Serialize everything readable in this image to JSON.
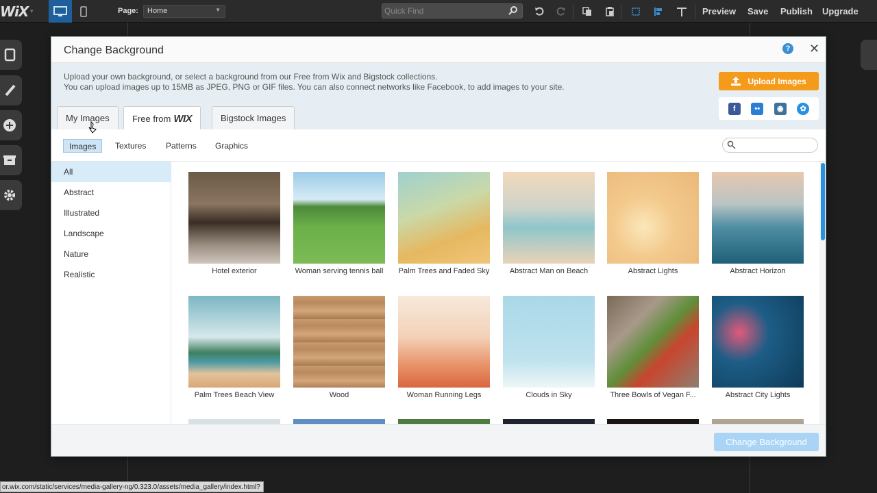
{
  "topbar": {
    "logo": "WiX",
    "page_label": "Page:",
    "page_select": "Home",
    "quickfind_placeholder": "Quick Find",
    "links": [
      "Preview",
      "Save",
      "Publish",
      "Upgrade"
    ]
  },
  "status_url": "or.wix.com/static/services/media-gallery-ng/0.323.0/assets/media_gallery/index.html?",
  "dialog": {
    "title": "Change Background",
    "description_line1": "Upload your own background, or select a background from our Free from Wix and Bigstock collections.",
    "description_line2": "You can upload images up to 15MB as JPEG, PNG or GIF files. You can also connect networks like Facebook, to add images to your site.",
    "upload_button": "Upload Images",
    "social": [
      "facebook",
      "flickr",
      "instagram",
      "picasa"
    ],
    "tabs": {
      "my_images": "My Images",
      "free_from": "Free from",
      "free_brand": "WIX",
      "bigstock": "Bigstock Images"
    },
    "subtabs": [
      "Images",
      "Textures",
      "Patterns",
      "Graphics"
    ],
    "categories": [
      "All",
      "Abstract",
      "Illustrated",
      "Landscape",
      "Nature",
      "Realistic"
    ],
    "images": [
      {
        "caption": "Hotel exterior",
        "bg": "linear-gradient(180deg,#6b5a48 0%,#8a7560 35%,#3a2e24 55%,#9b8f82 80%,#cfc6bc 100%)"
      },
      {
        "caption": "Woman serving tennis ball",
        "bg": "linear-gradient(180deg,#9ccbe8 0%,#d6ecf6 30%,#4d8a3a 38%,#6bb04a 60%,#7dbb56 100%)"
      },
      {
        "caption": "Palm Trees and Faded Sky",
        "bg": "linear-gradient(160deg,#9fd0cf 0%,#c9d9a8 40%,#e6b860 70%,#f0c578 100%)"
      },
      {
        "caption": "Abstract Man on Beach",
        "bg": "linear-gradient(180deg,#f2d9bb 0%,#cdd3c9 40%,#8fc6cb 60%,#e9d3b7 100%)"
      },
      {
        "caption": "Abstract Lights",
        "bg": "radial-gradient(circle at 40% 60%,#fbe7b9 0%,#f3c98c 40%,#eab87a 100%)"
      },
      {
        "caption": "Abstract Horizon",
        "bg": "linear-gradient(180deg,#e8c7ae 0%,#b9c4c4 35%,#4f8ea3 60%,#1f5f78 100%)"
      },
      {
        "caption": "Palm Trees Beach View",
        "bg": "linear-gradient(180deg,#7bb7c3 0%,#d6e8ea 45%,#3f7f60 62%,#4a9aa5 72%,#e2c39c 85%,#d8a874 100%)"
      },
      {
        "caption": "Wood",
        "bg": "repeating-linear-gradient(180deg,#c89a6c 0px,#b98a5e 10px,#d3a779 22px,#a97a52 34px)"
      },
      {
        "caption": "Woman Running Legs",
        "bg": "linear-gradient(180deg,#f7e9dc 0%,#f3d1b7 45%,#e8946a 75%,#d9663f 100%)"
      },
      {
        "caption": "Clouds in Sky",
        "bg": "linear-gradient(180deg,#a9d8e8 0%,#bfe2ee 70%,#eef6f7 100%)"
      },
      {
        "caption": "Three Bowls of Vegan F...",
        "bg": "linear-gradient(135deg,#7a6a5a 0%,#a8998a 30%,#5f8f3a 50%,#c8452e 65%,#8e7f70 100%)"
      },
      {
        "caption": "Abstract City Lights",
        "bg": "radial-gradient(circle at 30% 40%,#e05a7a 0%,#1d5d86 35%,#0d3b57 100%)"
      },
      {
        "caption": "",
        "bg": "linear-gradient(180deg,#d9e2e4 0%,#b6c4c6 100%)"
      },
      {
        "caption": "",
        "bg": "linear-gradient(180deg,#5f8fc4 0%,#3c6aa0 100%)"
      },
      {
        "caption": "",
        "bg": "linear-gradient(180deg,#4e7a3f 0%,#7fa86a 100%)"
      },
      {
        "caption": "",
        "bg": "linear-gradient(180deg,#1d2130 0%,#2f3548 100%)"
      },
      {
        "caption": "",
        "bg": "linear-gradient(180deg,#1c1414 0%,#3a2a2a 100%)"
      },
      {
        "caption": "",
        "bg": "linear-gradient(180deg,#b2a596 0%,#8a7e71 100%)"
      }
    ],
    "change_button": "Change Background"
  },
  "colors": {
    "upload": "#f59b1b",
    "accent": "#2a90e0",
    "change_disabled": "#a9d4f5"
  }
}
